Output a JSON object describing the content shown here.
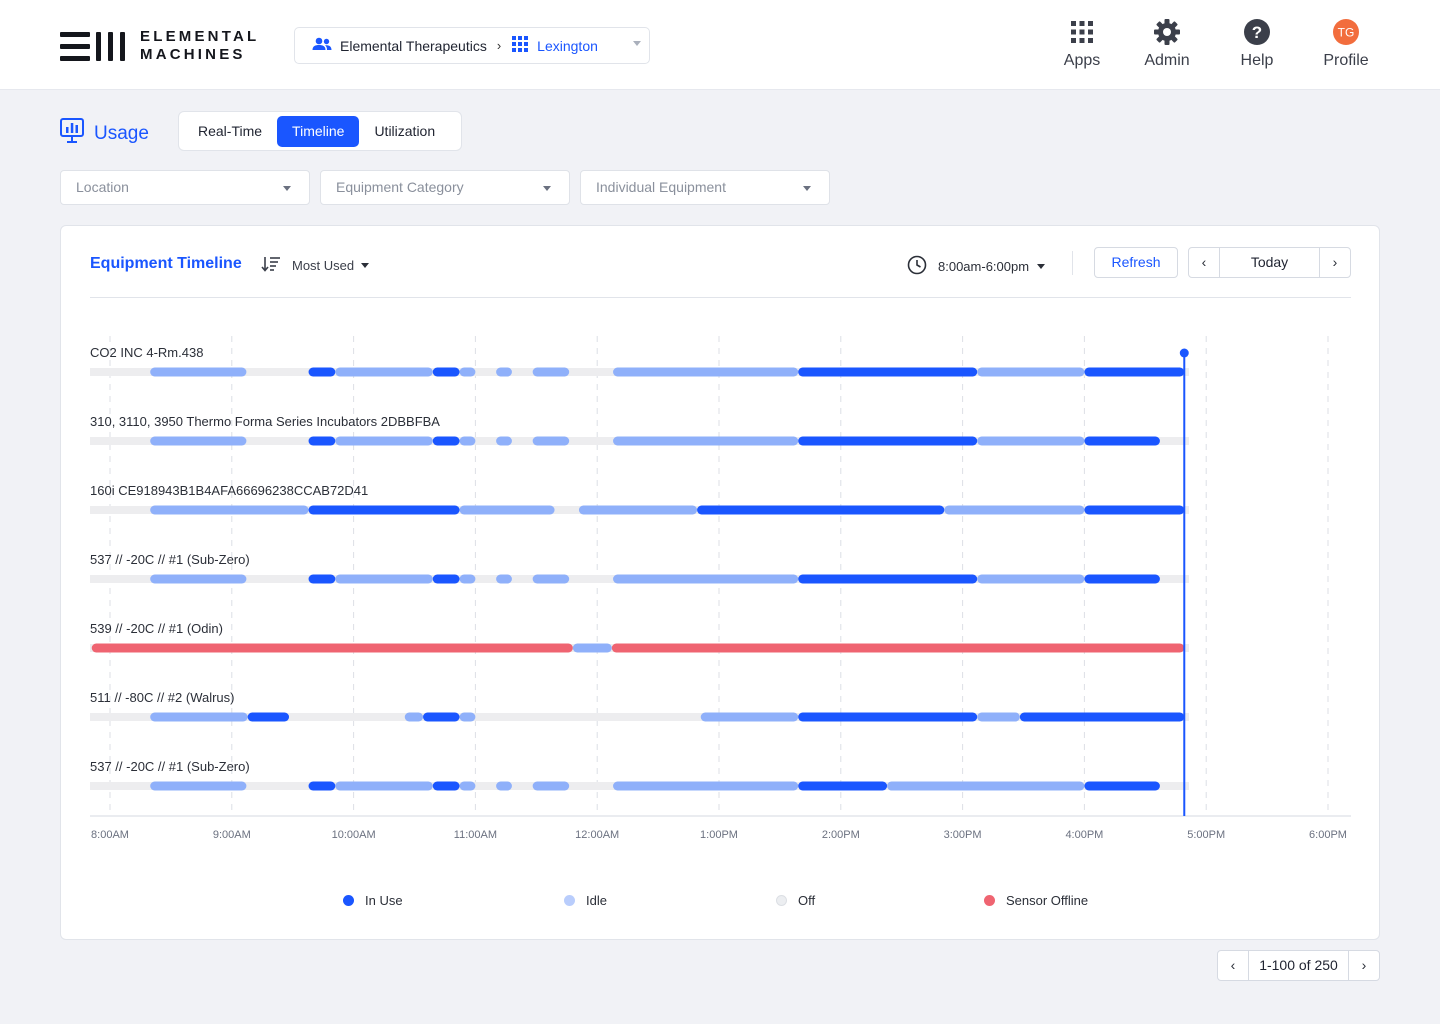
{
  "brand": {
    "line1": "ELEMENTAL",
    "line2": "MACHINES",
    "icon": "elemental-machines-logo"
  },
  "org_picker": {
    "org": "Elemental Therapeutics",
    "site": "Lexington",
    "org_icon": "people-icon",
    "site_icon": "grid-icon"
  },
  "nav": [
    {
      "label": "Apps",
      "icon": "apps-grid-icon"
    },
    {
      "label": "Admin",
      "icon": "gear-icon"
    },
    {
      "label": "Help",
      "icon": "help-icon"
    },
    {
      "label": "Profile",
      "icon": "avatar",
      "initials": "TG"
    }
  ],
  "page": {
    "title": "Usage",
    "icon": "usage-monitor-icon",
    "tabs": [
      {
        "label": "Real-Time",
        "active": false
      },
      {
        "label": "Timeline",
        "active": true
      },
      {
        "label": "Utilization",
        "active": false
      }
    ]
  },
  "filters": [
    {
      "placeholder": "Location"
    },
    {
      "placeholder": "Equipment Category"
    },
    {
      "placeholder": "Individual Equipment"
    }
  ],
  "card": {
    "title": "Equipment Timeline",
    "sort_label": "Most Used",
    "time_range": "8:00am-6:00pm",
    "refresh_label": "Refresh",
    "date_label": "Today",
    "prev": "‹",
    "next": "›"
  },
  "colors": {
    "in_use": "#1a56ff",
    "idle": "#8fb0fa",
    "off": "#ededef",
    "sensor_offline": "#ef6471",
    "accent": "#1a56ff"
  },
  "chart_data": {
    "type": "timeline",
    "x_ticks": [
      "8:00AM",
      "9:00AM",
      "10:00AM",
      "11:00AM",
      "12:00AM",
      "1:00PM",
      "2:00PM",
      "3:00PM",
      "4:00PM",
      "5:00PM",
      "6:00PM"
    ],
    "x_range": [
      "8:00AM",
      "6:00PM"
    ],
    "current_time_hours": 8.82,
    "states": [
      "in_use",
      "idle",
      "off",
      "sensor_offline"
    ],
    "rows": [
      {
        "name": "CO2 INC 4-Rm.438",
        "segments": [
          [
            "idle",
            0.33,
            1.12
          ],
          [
            "in_use",
            1.63,
            1.85
          ],
          [
            "idle",
            1.85,
            2.65
          ],
          [
            "in_use",
            2.65,
            2.87
          ],
          [
            "idle",
            2.87,
            3.0
          ],
          [
            "idle",
            3.17,
            3.3
          ],
          [
            "idle",
            3.47,
            3.77
          ],
          [
            "idle",
            4.13,
            5.65
          ],
          [
            "in_use",
            5.65,
            7.12
          ],
          [
            "idle",
            7.12,
            8.0
          ],
          [
            "in_use",
            8.0,
            8.82
          ]
        ]
      },
      {
        "name": "310, 3110, 3950 Thermo Forma Series Incubators 2DBBFBA",
        "segments": [
          [
            "idle",
            0.33,
            1.12
          ],
          [
            "in_use",
            1.63,
            1.85
          ],
          [
            "idle",
            1.85,
            2.65
          ],
          [
            "in_use",
            2.65,
            2.87
          ],
          [
            "idle",
            2.87,
            3.0
          ],
          [
            "idle",
            3.17,
            3.3
          ],
          [
            "idle",
            3.47,
            3.77
          ],
          [
            "idle",
            4.13,
            5.65
          ],
          [
            "in_use",
            5.65,
            7.12
          ],
          [
            "idle",
            7.12,
            8.0
          ],
          [
            "in_use",
            8.0,
            8.62
          ]
        ]
      },
      {
        "name": "160i CE918943B1B4AFA66696238CCAB72D41",
        "segments": [
          [
            "idle",
            0.33,
            1.63
          ],
          [
            "in_use",
            1.63,
            2.87
          ],
          [
            "idle",
            2.87,
            3.65
          ],
          [
            "idle",
            3.85,
            4.82
          ],
          [
            "in_use",
            4.82,
            6.85
          ],
          [
            "idle",
            6.85,
            8.0
          ],
          [
            "in_use",
            8.0,
            8.82
          ]
        ]
      },
      {
        "name": "537 // -20C // #1 (Sub-Zero)",
        "segments": [
          [
            "idle",
            0.33,
            1.12
          ],
          [
            "in_use",
            1.63,
            1.85
          ],
          [
            "idle",
            1.85,
            2.65
          ],
          [
            "in_use",
            2.65,
            2.87
          ],
          [
            "idle",
            2.87,
            3.0
          ],
          [
            "idle",
            3.17,
            3.3
          ],
          [
            "idle",
            3.47,
            3.77
          ],
          [
            "idle",
            4.13,
            5.65
          ],
          [
            "in_use",
            5.65,
            7.12
          ],
          [
            "idle",
            7.12,
            8.0
          ],
          [
            "in_use",
            8.0,
            8.62
          ]
        ]
      },
      {
        "name": "539 // -20C // #1 (Odin)",
        "segments": [
          [
            "sensor_offline",
            -0.15,
            3.8
          ],
          [
            "idle",
            3.8,
            4.12
          ],
          [
            "sensor_offline",
            4.12,
            8.82
          ]
        ]
      },
      {
        "name": "511 // -80C // #2 (Walrus)",
        "segments": [
          [
            "idle",
            0.33,
            1.13
          ],
          [
            "in_use",
            1.13,
            1.47
          ],
          [
            "idle",
            2.42,
            2.57
          ],
          [
            "in_use",
            2.57,
            2.87
          ],
          [
            "idle",
            2.87,
            3.0
          ],
          [
            "idle",
            4.85,
            5.65
          ],
          [
            "in_use",
            5.65,
            7.12
          ],
          [
            "idle",
            7.12,
            7.47
          ],
          [
            "in_use",
            7.47,
            8.82
          ]
        ]
      },
      {
        "name": "537 // -20C // #1 (Sub-Zero)",
        "segments": [
          [
            "idle",
            0.33,
            1.12
          ],
          [
            "in_use",
            1.63,
            1.85
          ],
          [
            "idle",
            1.85,
            2.65
          ],
          [
            "in_use",
            2.65,
            2.87
          ],
          [
            "idle",
            2.87,
            3.0
          ],
          [
            "idle",
            3.17,
            3.3
          ],
          [
            "idle",
            3.47,
            3.77
          ],
          [
            "idle",
            4.13,
            5.65
          ],
          [
            "in_use",
            5.65,
            6.38
          ],
          [
            "idle",
            6.38,
            8.0
          ],
          [
            "in_use",
            8.0,
            8.62
          ]
        ]
      }
    ],
    "legend": [
      {
        "label": "In Use",
        "state": "in_use"
      },
      {
        "label": "Idle",
        "state": "idle"
      },
      {
        "label": "Off",
        "state": "off"
      },
      {
        "label": "Sensor Offline",
        "state": "sensor_offline"
      }
    ]
  },
  "pagination": {
    "label": "1-100 of 250",
    "prev": "‹",
    "next": "›"
  }
}
